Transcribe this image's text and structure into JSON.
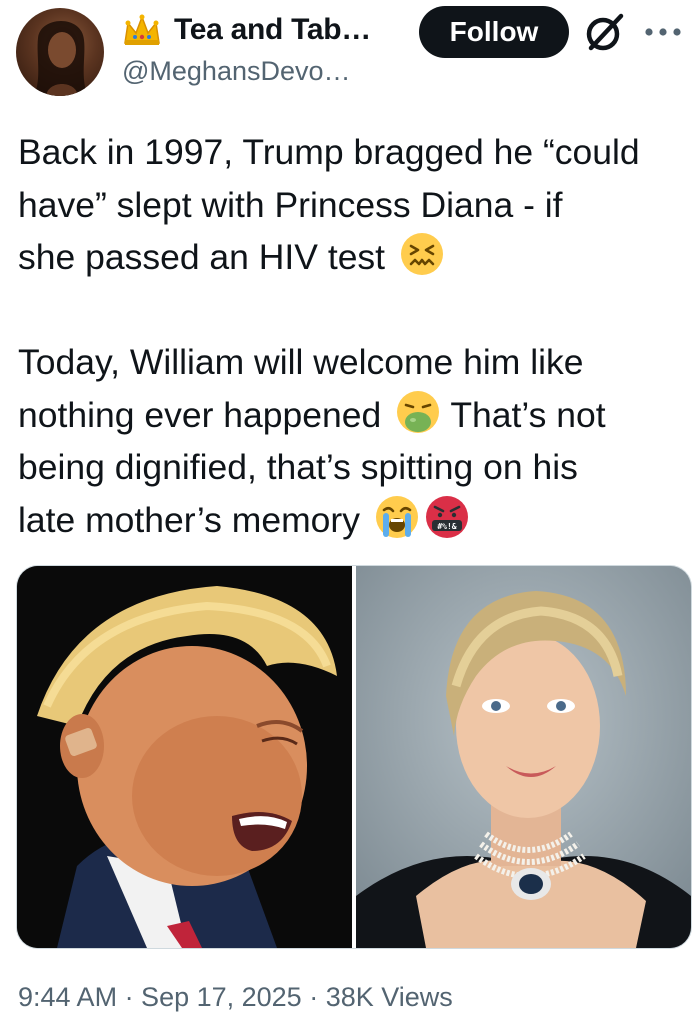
{
  "author": {
    "display_name": "Tea and Tab…",
    "handle": "@MeghansDevo…",
    "avatar_desc": "profile photo"
  },
  "actions": {
    "follow_label": "Follow"
  },
  "icons": {
    "crown": "crown-icon",
    "grok": "grok-icon",
    "more": "more-dots-icon"
  },
  "tweet": {
    "paragraph1": {
      "line1": "Back in 1997, Trump bragged he “could",
      "line2": "have” slept with Princess Diana - if",
      "line3": "she passed an HIV test"
    },
    "paragraph2": {
      "line1": "Today, William will welcome him like",
      "line2a": "nothing ever happened",
      "line2b": "That’s not",
      "line3": "being dignified, that’s spitting on his",
      "line4": "late mother’s memory"
    },
    "emojis": [
      "confounded-face",
      "nauseated-vomiting-face",
      "loudly-crying-face",
      "face-with-symbols-on-mouth"
    ]
  },
  "media": {
    "left_alt": "Photo of Donald Trump",
    "right_alt": "Photo of Princess Diana"
  },
  "meta": {
    "timestamp_partial": "9:44 AM · Sep 17, 2025 · 38K Views"
  },
  "colors": {
    "text": "#0f1419",
    "secondary": "#536471",
    "follow_bg": "#0f1419",
    "border": "#cfd9de"
  }
}
